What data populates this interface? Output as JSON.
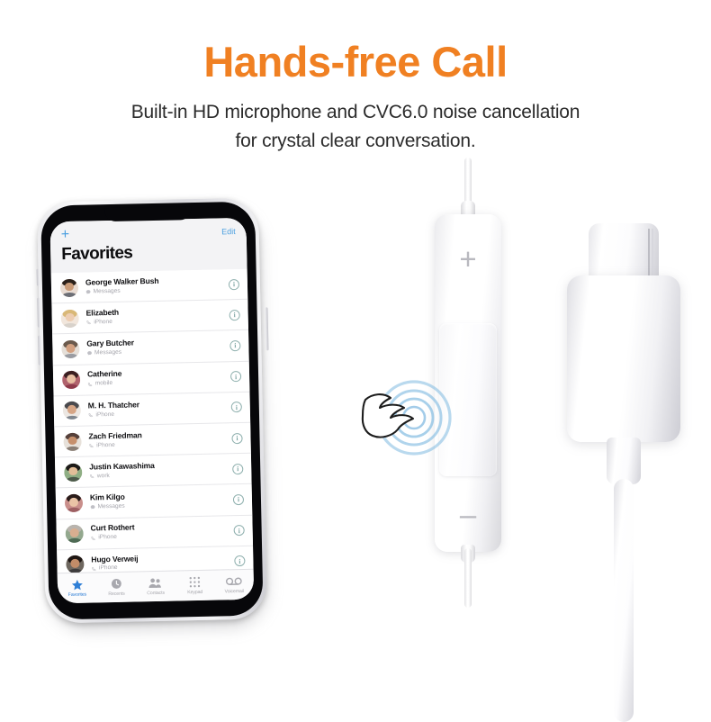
{
  "promo": {
    "headline": "Hands-free Call",
    "headline_color": "#F08022",
    "subtitle_line1": "Built-in HD microphone and CVC6.0 noise cancellation",
    "subtitle_line2": "for crystal clear conversation."
  },
  "phone": {
    "nav": {
      "add_label": "+",
      "edit_label": "Edit",
      "title": "Favorites",
      "accent_color": "#4A9FE0"
    },
    "contacts": [
      {
        "name": "George Walker Bush",
        "subtitle": "Messages",
        "sub_icon": "message-bubble-icon",
        "hair": "#2b201a",
        "skin": "#c99a77",
        "body": "#6d6f76",
        "bg": "#e9dcd3"
      },
      {
        "name": "Elizabeth",
        "subtitle": "iPhone",
        "sub_icon": "phone-handset-icon",
        "hair": "#d9b877",
        "skin": "#edcdb2",
        "body": "#d8d2cb",
        "bg": "#f1e6dc"
      },
      {
        "name": "Gary Butcher",
        "subtitle": "Messages",
        "sub_icon": "message-bubble-icon",
        "hair": "#6b5a4c",
        "skin": "#d3a181",
        "body": "#9a9ca2",
        "bg": "#e5dfd8"
      },
      {
        "name": "Catherine",
        "subtitle": "mobile",
        "sub_icon": "phone-handset-icon",
        "hair": "#3b1f20",
        "skin": "#e8bfa2",
        "body": "#8e3a4a",
        "bg": "#b0636d"
      },
      {
        "name": "M. H. Thatcher",
        "subtitle": "iPhone",
        "sub_icon": "phone-handset-icon",
        "hair": "#4a4a4e",
        "skin": "#d6a585",
        "body": "#7f868e",
        "bg": "#ece7e2"
      },
      {
        "name": "Zach Friedman",
        "subtitle": "iPhone",
        "sub_icon": "phone-handset-icon",
        "hair": "#55403a",
        "skin": "#c6906d",
        "body": "#8a7f76",
        "bg": "#e7e1da"
      },
      {
        "name": "Justin Kawashima",
        "subtitle": "work",
        "sub_icon": "phone-handset-icon",
        "hair": "#1d1a18",
        "skin": "#e3be98",
        "body": "#4d5a4a",
        "bg": "#8fae84"
      },
      {
        "name": "Kim Kilgo",
        "subtitle": "Messages",
        "sub_icon": "message-bubble-icon",
        "hair": "#2a1c1a",
        "skin": "#eac4a6",
        "body": "#9d5f62",
        "bg": "#c98f8b"
      },
      {
        "name": "Curt Rothert",
        "subtitle": "iPhone",
        "sub_icon": "phone-handset-icon",
        "hair": "#b9b4ae",
        "skin": "#d8ae90",
        "body": "#4f6b55",
        "bg": "#93a88e"
      },
      {
        "name": "Hugo Verweij",
        "subtitle": "iPhone",
        "sub_icon": "phone-handset-icon",
        "hair": "#1f1714",
        "skin": "#c28c68",
        "body": "#3d3b3c",
        "bg": "#6e675f"
      }
    ],
    "info_button_label": "i",
    "tabs": [
      {
        "label": "Favorites",
        "icon": "star-icon",
        "active": true
      },
      {
        "label": "Recents",
        "icon": "clock-icon",
        "active": false
      },
      {
        "label": "Contacts",
        "icon": "people-icon",
        "active": false
      },
      {
        "label": "Keypad",
        "icon": "keypad-icon",
        "active": false
      },
      {
        "label": "Voicemail",
        "icon": "voicemail-icon",
        "active": false
      }
    ]
  },
  "earphone_remote": {
    "volume_up_label": "+",
    "volume_down_label": "–",
    "center_button_name": "multifunction-button",
    "gesture": {
      "icon": "hand-tap-icon",
      "ripple_color": "#7FB9E0"
    }
  },
  "connector": {
    "type": "usb-c-connector"
  }
}
